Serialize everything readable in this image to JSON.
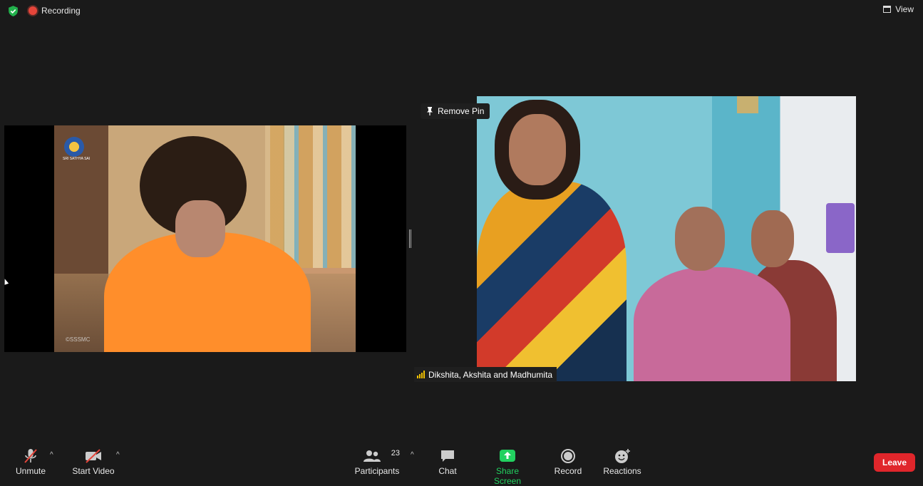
{
  "topbar": {
    "recording_label": "Recording",
    "view_label": "View"
  },
  "left_video": {
    "logo_text": "SRI SATHYA SAI",
    "watermark": "©SSSMC"
  },
  "right_video": {
    "pin_label": "Remove Pin",
    "participant_name": "Dikshita, Akshita and Madhumita"
  },
  "toolbar": {
    "unmute_label": "Unmute",
    "start_video_label": "Start Video",
    "participants_label": "Participants",
    "participants_count": "23",
    "chat_label": "Chat",
    "share_screen_label": "Share Screen",
    "record_label": "Record",
    "reactions_label": "Reactions",
    "leave_label": "Leave"
  },
  "colors": {
    "background": "#1a1a1a",
    "share_green": "#22d160",
    "leave_red": "#e0262b",
    "recording_red": "#e5453a"
  }
}
